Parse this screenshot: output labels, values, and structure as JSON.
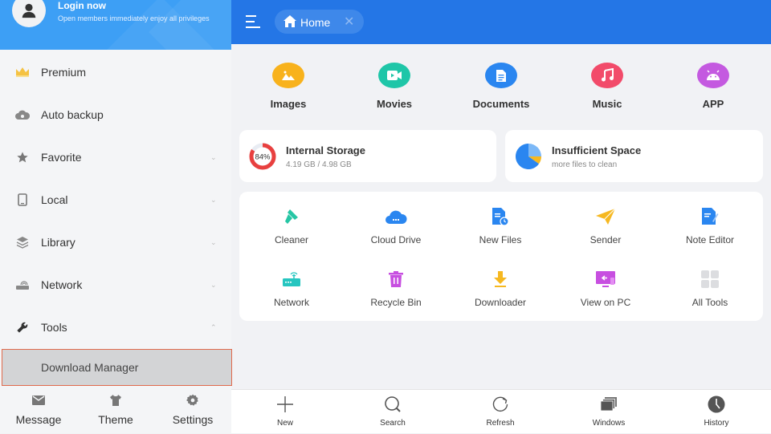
{
  "sidebar": {
    "login_title": "Login now",
    "login_subtitle": "Open members immediately enjoy all privileges",
    "items": [
      {
        "label": "Premium",
        "icon": "crown-icon",
        "expandable": false
      },
      {
        "label": "Auto backup",
        "icon": "cloud-backup-icon",
        "expandable": false
      },
      {
        "label": "Favorite",
        "icon": "star-icon",
        "expandable": true
      },
      {
        "label": "Local",
        "icon": "phone-icon",
        "expandable": true
      },
      {
        "label": "Library",
        "icon": "layers-icon",
        "expandable": true
      },
      {
        "label": "Network",
        "icon": "router-icon",
        "expandable": true
      },
      {
        "label": "Tools",
        "icon": "wrench-icon",
        "expandable": true,
        "expanded": true
      }
    ],
    "chevron_down": "⌄",
    "chevron_up": "⌃",
    "selected_subitem": "Download Manager",
    "bottom": [
      {
        "label": "Message",
        "icon": "envelope-icon"
      },
      {
        "label": "Theme",
        "icon": "shirt-icon"
      },
      {
        "label": "Settings",
        "icon": "gear-icon"
      }
    ]
  },
  "topbar": {
    "tab_label": "Home",
    "tab_close": "✕"
  },
  "categories": [
    {
      "label": "Images",
      "icon": "image-icon",
      "color": "#f8b21c"
    },
    {
      "label": "Movies",
      "icon": "video-icon",
      "color": "#1fc6a8"
    },
    {
      "label": "Documents",
      "icon": "document-icon",
      "color": "#2a86f0"
    },
    {
      "label": "Music",
      "icon": "music-icon",
      "color": "#f24b6a"
    },
    {
      "label": "APP",
      "icon": "android-icon",
      "color": "#c45ae0"
    }
  ],
  "storage": {
    "title": "Internal Storage",
    "usage": "4.19 GB / 4.98 GB",
    "percent_label": "84%",
    "percent": 84,
    "ring_color": "#e8403f"
  },
  "space": {
    "title": "Insufficient Space",
    "subtitle": "more files to clean"
  },
  "tools": [
    {
      "label": "Cleaner",
      "icon": "brush-icon"
    },
    {
      "label": "Cloud Drive",
      "icon": "cloud-drive-icon"
    },
    {
      "label": "New Files",
      "icon": "new-files-icon"
    },
    {
      "label": "Sender",
      "icon": "paper-plane-icon"
    },
    {
      "label": "Note Editor",
      "icon": "note-editor-icon"
    },
    {
      "label": "Network",
      "icon": "router-icon"
    },
    {
      "label": "Recycle Bin",
      "icon": "trash-icon"
    },
    {
      "label": "Downloader",
      "icon": "download-icon"
    },
    {
      "label": "View on PC",
      "icon": "monitor-icon"
    },
    {
      "label": "All Tools",
      "icon": "grid-icon"
    }
  ],
  "bottombar": [
    {
      "label": "New",
      "icon": "plus-icon"
    },
    {
      "label": "Search",
      "icon": "search-icon"
    },
    {
      "label": "Refresh",
      "icon": "refresh-icon"
    },
    {
      "label": "Windows",
      "icon": "windows-icon"
    },
    {
      "label": "History",
      "icon": "clock-icon"
    }
  ]
}
